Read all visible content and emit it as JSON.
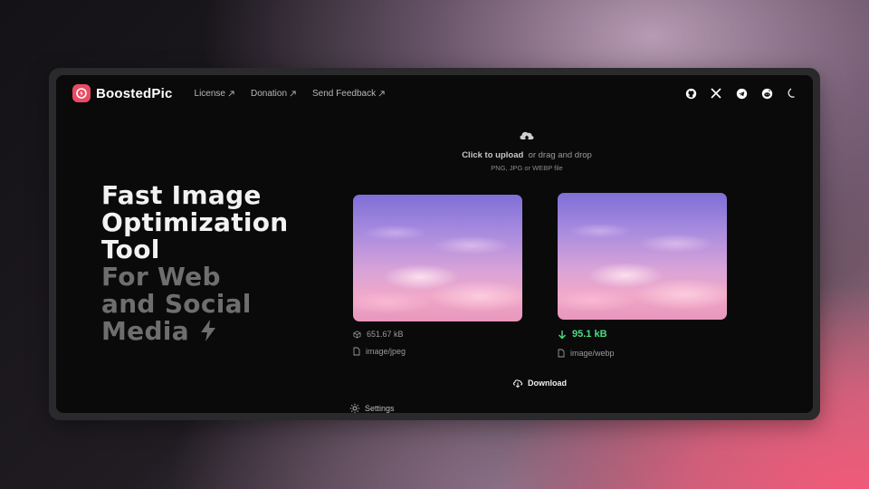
{
  "app": {
    "name": "BoostedPic",
    "accent": "#e94b63"
  },
  "nav": {
    "links": [
      {
        "label": "License"
      },
      {
        "label": "Donation"
      },
      {
        "label": "Send Feedback"
      }
    ],
    "icons": [
      "github-icon",
      "x-icon",
      "telegram-icon",
      "reddit-icon",
      "moon-icon"
    ]
  },
  "upload": {
    "cta": "Click to upload",
    "rest": "or drag and drop",
    "formats": "PNG, JPG or WEBP file"
  },
  "hero": {
    "line1": "Fast Image",
    "line2": "Optimization",
    "line3": "Tool",
    "line4": "For Web",
    "line5": "and Social",
    "line6": "Media"
  },
  "original": {
    "size": "651.67 kB",
    "type": "image/jpeg"
  },
  "optimized": {
    "size": "95.1 kB",
    "type": "image/webp",
    "status_color": "#4ade80"
  },
  "actions": {
    "download": "Download",
    "settings": "Settings"
  }
}
